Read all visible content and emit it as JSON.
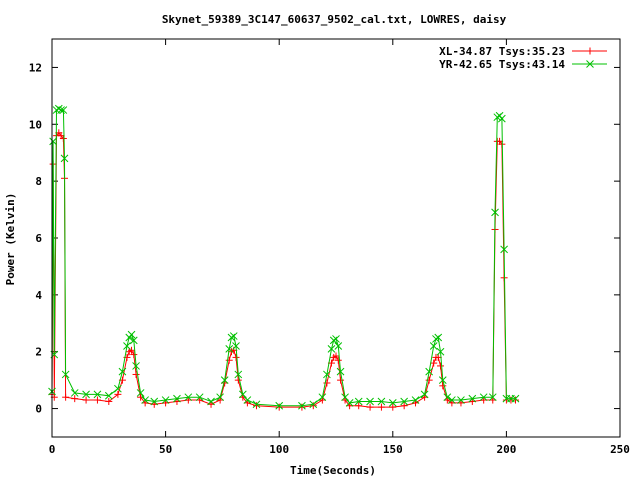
{
  "chart_data": {
    "type": "line",
    "title": "Skynet_59389_3C147_60637_9502_cal.txt, LOWRES, daisy",
    "xlabel": "Time(Seconds)",
    "ylabel": "Power (Kelvin)",
    "xlim": [
      0,
      250
    ],
    "ylim": [
      -1,
      13
    ],
    "xticks": [
      0,
      50,
      100,
      150,
      200,
      250
    ],
    "yticks": [
      0,
      2,
      4,
      6,
      8,
      10,
      12
    ],
    "grid": false,
    "legend_position": "top-right",
    "legend_entries": [
      "XL-34.87 Tsys:35.23",
      "YR-42.65 Tsys:43.14"
    ],
    "series": [
      {
        "name": "XL-34.87 Tsys:35.23",
        "color": "#ff0000",
        "marker": "plus",
        "x": [
          0,
          0.5,
          1,
          2,
          3,
          4,
          5,
          5.5,
          6,
          10,
          15,
          20,
          25,
          29,
          31,
          33,
          34,
          35,
          36,
          37,
          39,
          41,
          45,
          50,
          55,
          60,
          65,
          70,
          74,
          76,
          78,
          79,
          80,
          81,
          82,
          84,
          86,
          90,
          100,
          110,
          115,
          119,
          121,
          123,
          124,
          125,
          126,
          127,
          129,
          131,
          135,
          140,
          145,
          150,
          155,
          160,
          164,
          166,
          168,
          169,
          170,
          171,
          172,
          174,
          176,
          180,
          185,
          190,
          194,
          195,
          196,
          197,
          198,
          199,
          200,
          202,
          204
        ],
        "y": [
          0.5,
          8.6,
          0.4,
          9.6,
          9.7,
          9.6,
          9.5,
          8.1,
          0.4,
          0.35,
          0.3,
          0.3,
          0.25,
          0.5,
          1.0,
          1.8,
          2.0,
          2.05,
          1.9,
          1.2,
          0.4,
          0.2,
          0.15,
          0.2,
          0.25,
          0.3,
          0.3,
          0.15,
          0.3,
          0.9,
          1.7,
          2.0,
          2.05,
          1.8,
          1.0,
          0.4,
          0.2,
          0.1,
          0.05,
          0.05,
          0.1,
          0.3,
          0.9,
          1.6,
          1.8,
          1.85,
          1.7,
          1.0,
          0.3,
          0.1,
          0.1,
          0.05,
          0.05,
          0.05,
          0.1,
          0.2,
          0.4,
          1.0,
          1.6,
          1.8,
          1.8,
          1.5,
          0.8,
          0.3,
          0.2,
          0.2,
          0.25,
          0.3,
          0.3,
          6.3,
          9.4,
          9.4,
          9.3,
          4.6,
          0.3,
          0.3,
          0.3
        ]
      },
      {
        "name": "YR-42.65 Tsys:43.14",
        "color": "#00c000",
        "marker": "cross",
        "x": [
          0,
          0.5,
          1,
          2,
          3,
          4,
          5,
          5.5,
          6,
          10,
          15,
          20,
          25,
          29,
          31,
          33,
          34,
          35,
          36,
          37,
          39,
          41,
          45,
          50,
          55,
          60,
          65,
          70,
          74,
          76,
          78,
          79,
          80,
          81,
          82,
          84,
          86,
          90,
          100,
          110,
          115,
          119,
          121,
          123,
          124,
          125,
          126,
          127,
          129,
          131,
          135,
          140,
          145,
          150,
          155,
          160,
          164,
          166,
          168,
          169,
          170,
          171,
          172,
          174,
          176,
          180,
          185,
          190,
          194,
          195,
          196,
          197,
          198,
          199,
          200,
          202,
          204
        ],
        "y": [
          0.6,
          9.4,
          1.9,
          10.5,
          10.55,
          10.5,
          10.5,
          8.8,
          1.2,
          0.55,
          0.5,
          0.5,
          0.45,
          0.7,
          1.3,
          2.2,
          2.5,
          2.6,
          2.4,
          1.5,
          0.55,
          0.3,
          0.25,
          0.3,
          0.35,
          0.4,
          0.4,
          0.25,
          0.4,
          1.0,
          2.1,
          2.5,
          2.55,
          2.2,
          1.2,
          0.5,
          0.3,
          0.15,
          0.1,
          0.1,
          0.15,
          0.4,
          1.2,
          2.1,
          2.4,
          2.45,
          2.2,
          1.3,
          0.4,
          0.2,
          0.25,
          0.25,
          0.25,
          0.2,
          0.25,
          0.3,
          0.5,
          1.3,
          2.2,
          2.45,
          2.5,
          2.0,
          1.0,
          0.4,
          0.3,
          0.3,
          0.35,
          0.4,
          0.4,
          6.9,
          10.25,
          10.3,
          10.2,
          5.6,
          0.35,
          0.35,
          0.35
        ]
      }
    ]
  }
}
